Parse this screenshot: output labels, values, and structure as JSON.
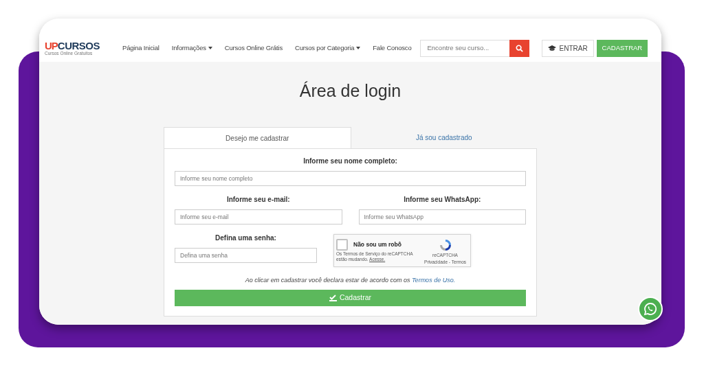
{
  "logo": {
    "brand_up": "UP",
    "brand_rest": "CURSOS",
    "tagline": "Cursos Online Gratuitos"
  },
  "nav": [
    {
      "label": "Página Inicial",
      "dropdown": false
    },
    {
      "label": "Informações",
      "dropdown": true
    },
    {
      "label": "Cursos Online Grátis",
      "dropdown": false
    },
    {
      "label": "Cursos por Categoria",
      "dropdown": true
    },
    {
      "label": "Fale Conosco",
      "dropdown": false
    }
  ],
  "search": {
    "placeholder": "Encontre seu curso..."
  },
  "buttons": [
    {
      "label": "ENTRAR",
      "kind": "outline"
    },
    {
      "label": "CADASTRAR",
      "kind": "success"
    }
  ],
  "title": "Área de login",
  "tabs": [
    {
      "label": "Desejo me cadastrar",
      "selected": true
    },
    {
      "label": "Já sou cadastrado",
      "selected": false
    }
  ],
  "rows": [
    [
      {
        "kind": "text",
        "label": "Informe seu nome completo:",
        "placeholder": "Informe seu nome completo"
      }
    ],
    [
      {
        "kind": "text",
        "label": "Informe seu e-mail:",
        "placeholder": "Informe seu e-mail"
      },
      {
        "kind": "text",
        "label": "Informe seu WhatsApp:",
        "placeholder": "Informe seu WhatsApp"
      }
    ],
    [
      {
        "kind": "text",
        "label": "Defina uma senha:",
        "placeholder": "Defina uma senha"
      },
      {
        "kind": "captcha",
        "label": "Não sou um robô",
        "checked": false,
        "brand": "reCAPTCHA",
        "notice": "Os Termos de Serviço do reCAPTCHA estão mudando.",
        "notice_link": "Acesse.",
        "links": "Privacidade - Termos"
      }
    ]
  ],
  "terms": {
    "text": "Ao clicar em cadastrar você declara estar de acordo com os",
    "link": "Termos de Uso."
  },
  "submit": "Cadastrar"
}
